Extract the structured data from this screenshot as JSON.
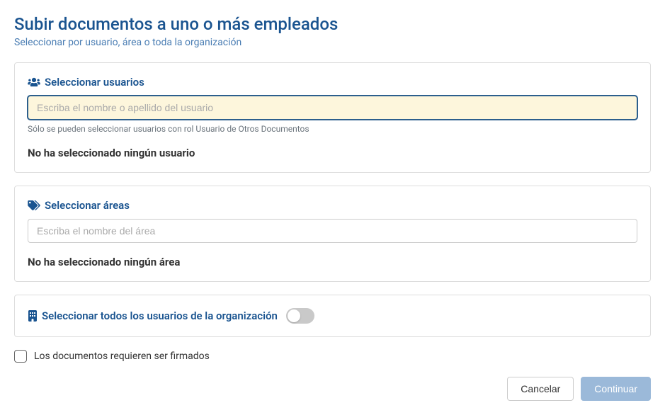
{
  "header": {
    "title": "Subir documentos a uno o más empleados",
    "subtitle": "Seleccionar por usuario, área o toda la organización"
  },
  "users_section": {
    "label": "Seleccionar usuarios",
    "placeholder": "Escriba el nombre o apellido del usuario",
    "helper": "Sólo se pueden seleccionar usuarios con rol Usuario de Otros Documentos",
    "empty_state": "No ha seleccionado ningún usuario"
  },
  "areas_section": {
    "label": "Seleccionar áreas",
    "placeholder": "Escriba el nombre del área",
    "empty_state": "No ha seleccionado ningún área"
  },
  "org_section": {
    "label": "Seleccionar todos los usuarios de la organización",
    "toggle_on": false
  },
  "signature_checkbox": {
    "label": "Los documentos requieren ser firmados",
    "checked": false
  },
  "buttons": {
    "cancel": "Cancelar",
    "continue": "Continuar"
  }
}
